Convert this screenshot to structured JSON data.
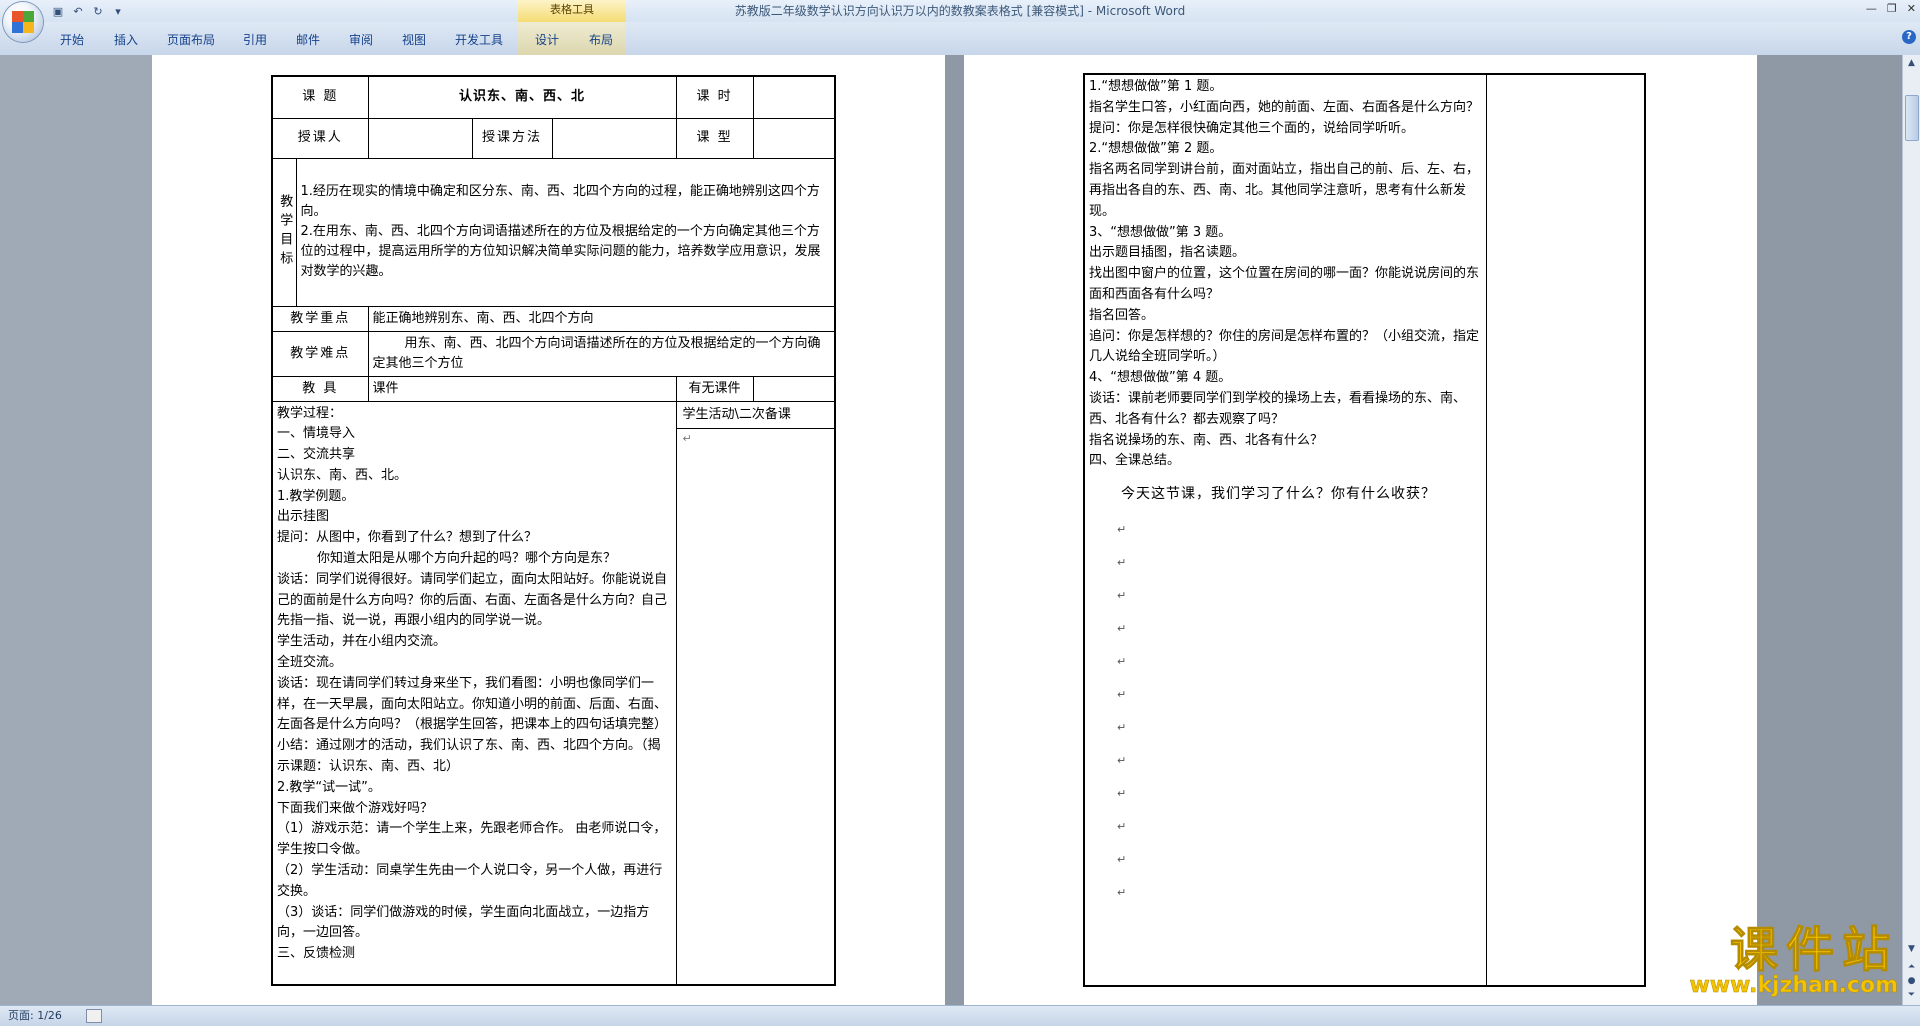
{
  "window": {
    "title": "苏教版二年级数学认识方向认识万以内的数教案表格式 [兼容模式] - Microsoft Word",
    "context_tab_group": "表格工具",
    "controls": [
      "—",
      "❐",
      "✕"
    ]
  },
  "ribbon": {
    "tabs": [
      "开始",
      "插入",
      "页面布局",
      "引用",
      "邮件",
      "审阅",
      "视图",
      "开发工具",
      "设计",
      "布局"
    ]
  },
  "page1": {
    "row1": {
      "topic_label": "课  题",
      "topic_value": "认识东、南、西、北",
      "hours_label": "课 时"
    },
    "row2": {
      "teacher_label": "授课人",
      "method_label": "授课方法",
      "type_label": "课 型"
    },
    "goals": {
      "label": "教学目标",
      "lines": [
        "1.经历在现实的情境中确定和区分东、南、西、北四个方向的过程，能正确地辨别这四个方向。",
        "2.在用东、南、西、北四个方向词语描述所在的方位及根据给定的一个方向确定其他三个方位的过程中，提高运用所学的方位知识解决简单实际问题的能力，培养数学应用意识，发展对数学的兴趣。"
      ]
    },
    "key_point": {
      "label": "教学重点",
      "value": "能正确地辨别东、南、西、北四个方向"
    },
    "difficulty": {
      "label": "教学难点",
      "value": "用东、南、西、北四个方向词语描述所在的方位及根据给定的一个方向确定其他三个方位"
    },
    "tools": {
      "label": "教    具",
      "value": "课件",
      "extra_label": "有无课件"
    },
    "process": {
      "side_label": "学生活动\\二次备课",
      "lines": [
        "教学过程：",
        "一、情境导入",
        "二、交流共享",
        "认识东、南、西、北。",
        "1.教学例题。",
        "出示挂图",
        "提问：从图中，你看到了什么？想到了什么？",
        "你知道太阳是从哪个方向升起的吗？哪个方向是东？",
        "谈话：同学们说得很好。请同学们起立，面向太阳站好。你能说说自己的面前是什么方向吗？你的后面、右面、左面各是什么方向？自己先指一指、说一说，再跟小组内的同学说一说。",
        "学生活动，并在小组内交流。",
        "全班交流。",
        "谈话：现在请同学们转过身来坐下，我们看图：小明也像同学们一样，在一天早晨，面向太阳站立。你知道小明的前面、后面、右面、左面各是什么方向吗？（根据学生回答，把课本上的四句话填完整）",
        "小结：通过刚才的活动，我们认识了东、南、西、北四个方向。（揭示课题：认识东、南、西、北）",
        "2.教学“试一试”。",
        "下面我们来做个游戏好吗？",
        "（1）游戏示范：请一个学生上来，先跟老师合作。  由老师说口令，学生按口令做。",
        "（2）学生活动：同桌学生先由一个人说口令，另一个人做，再进行交换。",
        "（3）谈话：同学们做游戏的时候，学生面向北面战立，一边指方向，一边回答。",
        "三、反馈检测"
      ]
    }
  },
  "page2": {
    "lines": [
      "1.“想想做做”第 1 题。",
      "指名学生口答，小红面向西，她的前面、左面、右面各是什么方向？",
      "提问：你是怎样很快确定其他三个面的，说给同学听听。",
      "2.“想想做做”第 2 题。",
      "指名两名同学到讲台前，面对面站立，指出自己的前、后、左、右，再指出各自的东、西、南、北。其他同学注意听，思考有什么新发现。",
      "3、“想想做做”第 3 题。",
      "出示题目插图，指名读题。",
      "找出图中窗户的位置，这个位置在房间的哪一面？你能说说房间的东面和西面各有什么吗？",
      "指名回答。",
      "追问：你是怎样想的？你住的房间是怎样布置的？（小组交流，指定几人说给全班同学听。）",
      "4、“想想做做”第 4 题。",
      "谈话：课前老师要同学们到学校的操场上去，看看操场的东、南、西、北各有什么？都去观察了吗？",
      "指名说操场的东、南、西、北各有什么？",
      "四、全课总结。"
    ],
    "summary": "今天这节课，我们学习了什么？你有什么收获？",
    "paragraph_mark": "↵"
  },
  "status": {
    "page": "页面: 1/26"
  },
  "watermark": {
    "cn": "课件站",
    "url": "www.kjzhan.com"
  },
  "colors": {
    "ribbon_text": "#15428b",
    "workspace": "#a0aab6",
    "watermark": "#f5c400"
  }
}
